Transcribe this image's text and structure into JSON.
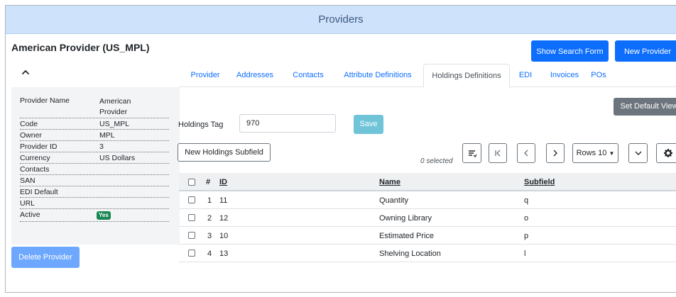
{
  "header": {
    "title": "Providers"
  },
  "provider_title": "American Provider (US_MPL)",
  "actions": {
    "show_search": "Show Search Form",
    "new_provider": "New Provider",
    "delete_provider": "Delete Provider"
  },
  "info": [
    {
      "label": "Provider Name",
      "value": "American Provider"
    },
    {
      "label": "Code",
      "value": "US_MPL"
    },
    {
      "label": "Owner",
      "value": "MPL"
    },
    {
      "label": "Provider ID",
      "value": "3"
    },
    {
      "label": "Currency",
      "value": "US Dollars"
    },
    {
      "label": "Contacts",
      "value": ""
    },
    {
      "label": "SAN",
      "value": ""
    },
    {
      "label": "EDI Default",
      "value": ""
    },
    {
      "label": "URL",
      "value": ""
    },
    {
      "label": "Active",
      "value": "Yes"
    }
  ],
  "tabs": [
    "Provider",
    "Addresses",
    "Contacts",
    "Attribute Definitions",
    "Holdings Definitions",
    "EDI",
    "Invoices",
    "POs"
  ],
  "active_tab": "Holdings Definitions",
  "set_default_view": "Set Default View",
  "form": {
    "holdings_tag_label": "Holdings Tag",
    "holdings_tag_value": "970",
    "save_label": "Save"
  },
  "grid": {
    "new_subfield": "New Holdings Subfield",
    "selected_text": "0 selected",
    "rows_label": "Rows 10",
    "columns": {
      "num": "#",
      "id": "ID",
      "name": "Name",
      "subfield": "Subfield"
    },
    "rows": [
      {
        "num": "1",
        "id": "11",
        "name": "Quantity",
        "subfield": "q"
      },
      {
        "num": "2",
        "id": "12",
        "name": "Owning Library",
        "subfield": "o"
      },
      {
        "num": "3",
        "id": "10",
        "name": "Estimated Price",
        "subfield": "p"
      },
      {
        "num": "4",
        "id": "13",
        "name": "Shelving Location",
        "subfield": "l"
      }
    ]
  },
  "colors": {
    "primary": "#0d6efd",
    "header_bg": "#cfe2fb",
    "success": "#198754",
    "info": "#6fc4d8"
  }
}
